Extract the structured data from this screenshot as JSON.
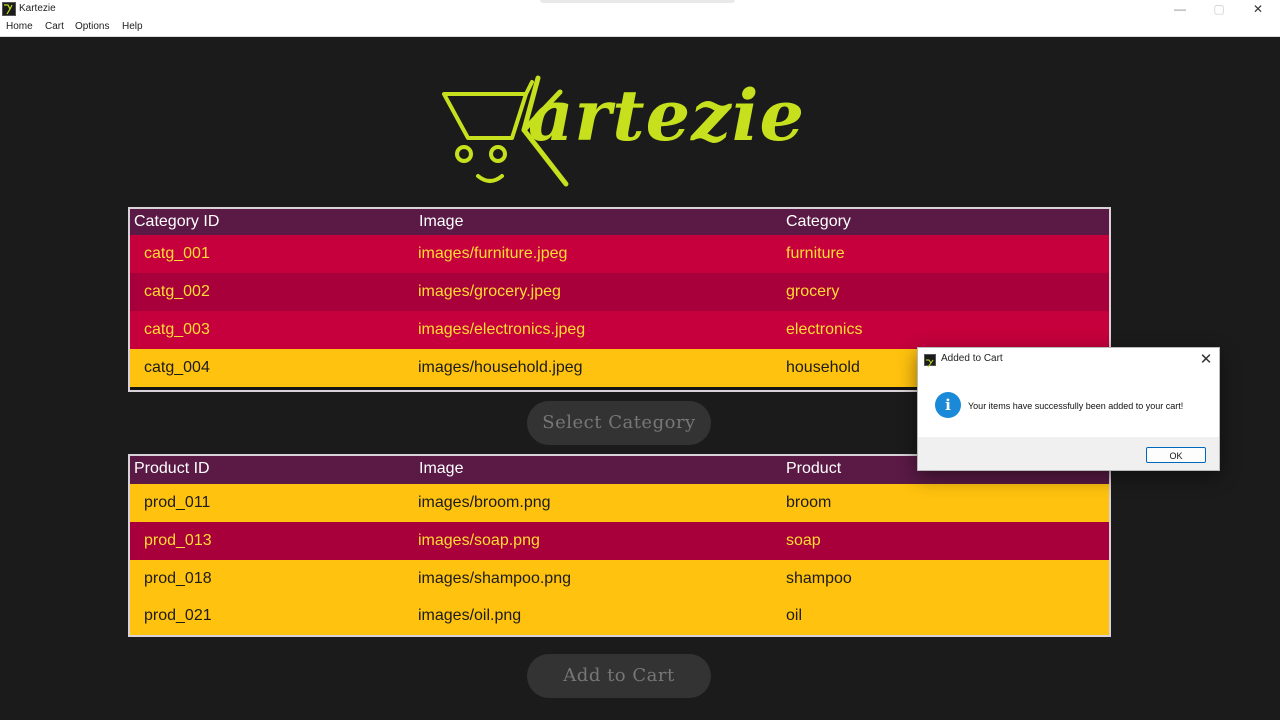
{
  "window": {
    "title": "Kartezie",
    "controls": {
      "minimize": "—",
      "maximize": "▢",
      "close": "✕"
    }
  },
  "menu": [
    "Home",
    "Cart",
    "Options",
    "Help"
  ],
  "logo": {
    "text": "artezie",
    "color": "#c6e01d"
  },
  "category_table": {
    "headers": [
      "Category ID",
      "Image",
      "Category"
    ],
    "rows": [
      [
        "catg_001",
        "images/furniture.jpeg",
        "furniture"
      ],
      [
        "catg_002",
        "images/grocery.jpeg",
        "grocery"
      ],
      [
        "catg_003",
        "images/electronics.jpeg",
        "electronics"
      ],
      [
        "catg_004",
        "images/household.jpeg",
        "household"
      ]
    ]
  },
  "select_category_button": "Select Category",
  "product_table": {
    "headers": [
      "Product ID",
      "Image",
      "Product"
    ],
    "rows": [
      [
        "prod_011",
        "images/broom.png",
        "broom"
      ],
      [
        "prod_013",
        "images/soap.png",
        "soap"
      ],
      [
        "prod_018",
        "images/shampoo.png",
        "shampoo"
      ],
      [
        "prod_021",
        "images/oil.png",
        "oil"
      ]
    ]
  },
  "add_to_cart_button": "Add to Cart",
  "dialog": {
    "title": "Added to Cart",
    "close": "✕",
    "icon": "info-icon",
    "message": "Your items have successfully been added to your cart!",
    "ok_label": "OK"
  },
  "colors": {
    "background": "#1b1b1b",
    "header": "#5a1a45",
    "row_red": "#c5003c",
    "row_selected": "#a8003a",
    "row_yellow": "#ffc20e",
    "accent_text": "#ffdd33"
  }
}
